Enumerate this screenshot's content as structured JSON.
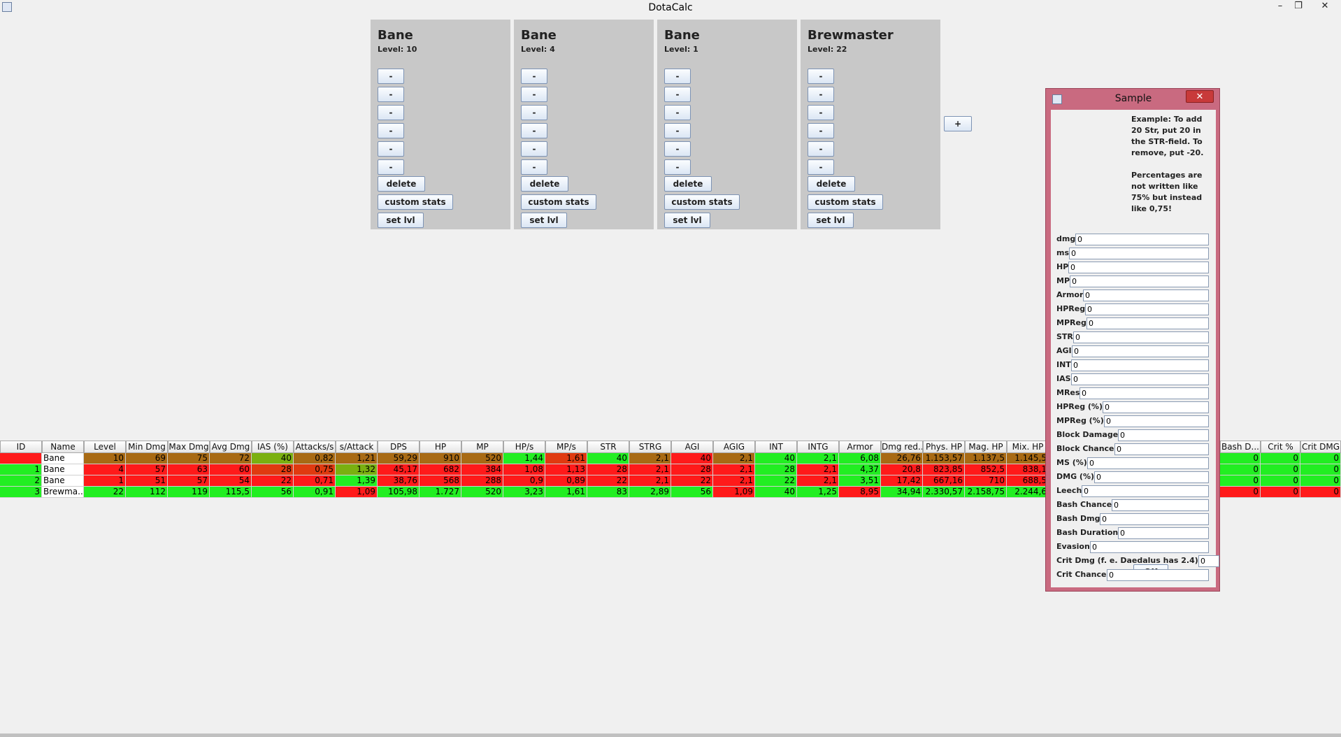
{
  "window": {
    "title": "DotaCalc",
    "controls": [
      "–",
      "❐",
      "✕"
    ]
  },
  "heroes": [
    {
      "name": "Bane",
      "level": "Level: 10",
      "stat_buttons": [
        "-",
        "-",
        "-",
        "-",
        "-",
        "-"
      ],
      "delete": "delete",
      "custom": "custom stats",
      "setlvl": "set lvl"
    },
    {
      "name": "Bane",
      "level": "Level: 4",
      "stat_buttons": [
        "-",
        "-",
        "-",
        "-",
        "-",
        "-"
      ],
      "delete": "delete",
      "custom": "custom stats",
      "setlvl": "set lvl"
    },
    {
      "name": "Bane",
      "level": "Level: 1",
      "stat_buttons": [
        "-",
        "-",
        "-",
        "-",
        "-",
        "-"
      ],
      "delete": "delete",
      "custom": "custom stats",
      "setlvl": "set lvl"
    },
    {
      "name": "Brewmaster",
      "level": "Level: 22",
      "stat_buttons": [
        "-",
        "-",
        "-",
        "-",
        "-",
        "-"
      ],
      "delete": "delete",
      "custom": "custom stats",
      "setlvl": "set lvl"
    }
  ],
  "add_hero_button": "+",
  "table": {
    "headers": [
      "ID",
      "Name",
      "Level",
      "Min Dmg",
      "Max Dmg",
      "Avg Dmg",
      "IAS (%)",
      "Attacks/s",
      "s/Attack",
      "DPS",
      "HP",
      "MP",
      "HP/s",
      "MP/s",
      "STR",
      "STRG",
      "AGI",
      "AGIG",
      "INT",
      "INTG",
      "Armor",
      "Dmg red...",
      "Phys. HP",
      "Mag. HP",
      "Mix. HP",
      "Bash D...",
      "Crit %",
      "Crit DMG"
    ],
    "rows": [
      [
        "",
        "Bane",
        "10",
        "69",
        "75",
        "72",
        "40",
        "0,82",
        "1,21",
        "59,29",
        "910",
        "520",
        "1,44",
        "1,61",
        "40",
        "2,1",
        "40",
        "2,1",
        "40",
        "2,1",
        "6,08",
        "26,76",
        "1.153,57",
        "1.137,5",
        "1.145,5",
        "0",
        "0",
        "0"
      ],
      [
        "1",
        "Bane",
        "4",
        "57",
        "63",
        "60",
        "28",
        "0,75",
        "1,32",
        "45,17",
        "682",
        "384",
        "1,08",
        "1,13",
        "28",
        "2,1",
        "28",
        "2,1",
        "28",
        "2,1",
        "4,37",
        "20,8",
        "823,85",
        "852,5",
        "838,1",
        "0",
        "0",
        "0"
      ],
      [
        "2",
        "Bane",
        "1",
        "51",
        "57",
        "54",
        "22",
        "0,71",
        "1,39",
        "38,76",
        "568",
        "288",
        "0,9",
        "0,89",
        "22",
        "2,1",
        "22",
        "2,1",
        "22",
        "2,1",
        "3,51",
        "17,42",
        "667,16",
        "710",
        "688,5",
        "0",
        "0",
        "0"
      ],
      [
        "3",
        "Brewma...",
        "22",
        "112",
        "119",
        "115,5",
        "56",
        "0,91",
        "1,09",
        "105,98",
        "1.727",
        "520",
        "3,23",
        "1,61",
        "83",
        "2,89",
        "56",
        "1,09",
        "40",
        "1,25",
        "8,95",
        "34,94",
        "2.330,57",
        "2.158,75",
        "2.244,6",
        "0",
        "0",
        "0"
      ]
    ]
  },
  "dialog": {
    "title": "Sample",
    "close": "✕",
    "help": "Example: To add\n20 Str, put 20 in\nthe STR-field. To\nremove, put -20.\n\nPercentages are\nnot written like\n75% but instead\nlike 0,75!",
    "fields": [
      {
        "label": "dmg",
        "value": "0"
      },
      {
        "label": "ms",
        "value": "0"
      },
      {
        "label": "HP",
        "value": "0"
      },
      {
        "label": "MP",
        "value": "0"
      },
      {
        "label": "Armor",
        "value": "0"
      },
      {
        "label": "HPReg",
        "value": "0"
      },
      {
        "label": "MPReg",
        "value": "0"
      },
      {
        "label": "STR",
        "value": "0"
      },
      {
        "label": "AGI",
        "value": "0"
      },
      {
        "label": "INT",
        "value": "0"
      },
      {
        "label": "IAS",
        "value": "0"
      },
      {
        "label": "MRes",
        "value": "0"
      },
      {
        "label": "HPReg (%)",
        "value": "0"
      },
      {
        "label": "MPReg (%)",
        "value": "0"
      },
      {
        "label": "Block Damage",
        "value": "0"
      },
      {
        "label": "Block Chance",
        "value": "0"
      },
      {
        "label": "MS (%)",
        "value": "0"
      },
      {
        "label": "DMG (%)",
        "value": "0"
      },
      {
        "label": "Leech",
        "value": "0"
      },
      {
        "label": "Bash Chance",
        "value": "0"
      },
      {
        "label": "Bash Dmg",
        "value": "0"
      },
      {
        "label": "Bash Duration",
        "value": "0"
      },
      {
        "label": "Evasion",
        "value": "0"
      },
      {
        "label": "Crit Dmg (f. e. Daedalus has 2.4)",
        "value": "0"
      },
      {
        "label": "Crit Chance",
        "value": "0"
      }
    ],
    "ok": "OK"
  }
}
